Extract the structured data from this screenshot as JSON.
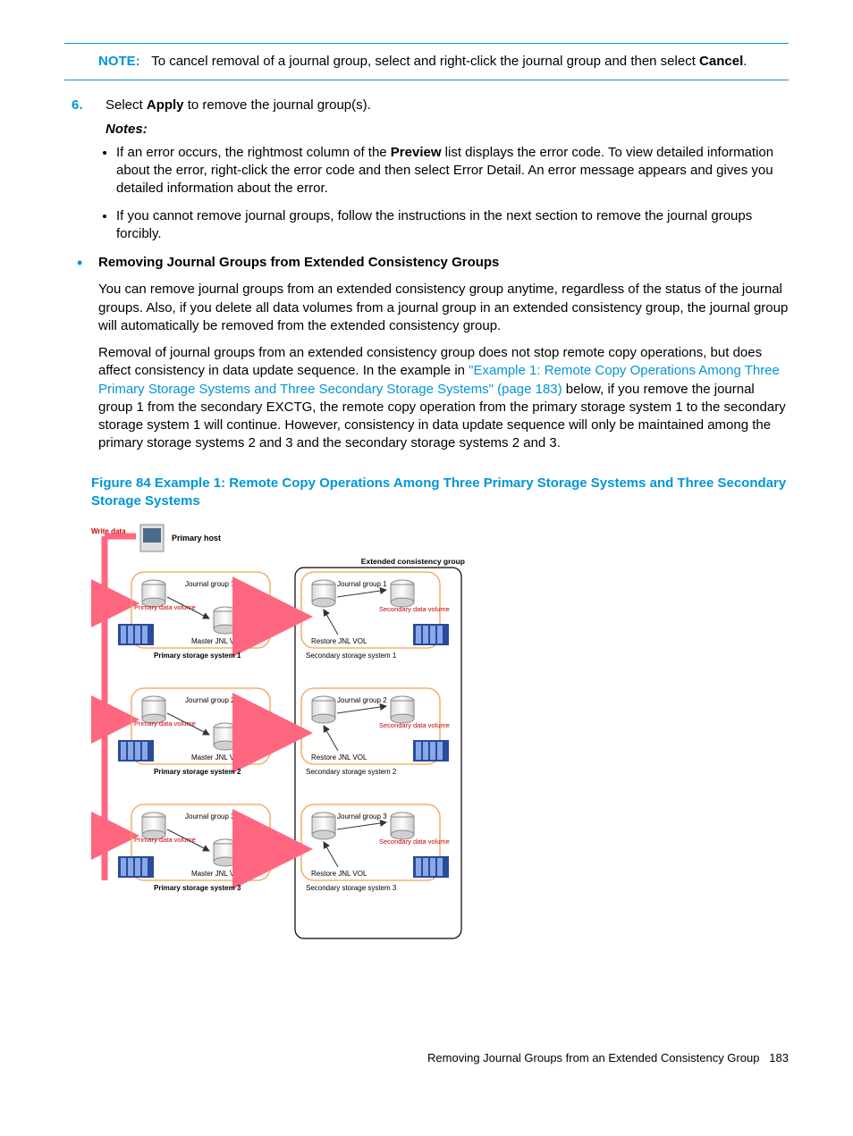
{
  "note": {
    "label": "NOTE:",
    "text1": "To cancel removal of a journal group, select and right-click the journal group and then select ",
    "bold": "Cancel",
    "text2": "."
  },
  "step6": {
    "num": "6.",
    "pre": "Select ",
    "bold": "Apply",
    "post": " to remove the journal group(s).",
    "notes_label": "Notes"
  },
  "bullets": {
    "b1_pre": "If an error occurs, the rightmost column of the ",
    "b1_bold": "Preview",
    "b1_post": " list displays the error code. To view detailed information about the error, right-click the error code and then select Error Detail. An error message appears and gives you detailed information about the error.",
    "b2": "If you cannot remove journal groups, follow the instructions in the next section to remove the journal groups forcibly."
  },
  "section": {
    "heading": "Removing Journal Groups from Extended Consistency Groups",
    "p1": "You can remove journal groups from an extended consistency group anytime, regardless of the status of the journal groups. Also, if you delete all data volumes from a journal group in an extended consistency group, the journal group will automatically be removed from the extended consistency group.",
    "p2_pre": "Removal of journal groups from an extended consistency group does not stop remote copy operations, but does affect consistency in data update sequence. In the example in ",
    "p2_link": "\"Example 1: Remote Copy Operations Among Three Primary Storage Systems and Three Secondary Storage Systems\" (page 183)",
    "p2_post": " below, if you remove the journal group 1 from the secondary EXCTG, the remote copy operation from the primary storage system 1 to the secondary storage system 1 will continue. However, consistency in data update sequence will only be maintained among the primary storage systems 2 and 3 and the secondary storage systems 2 and 3."
  },
  "figure": {
    "caption": "Figure 84 Example 1: Remote Copy Operations Among Three Primary Storage Systems and Three Secondary Storage Systems",
    "write_data": "Write data",
    "primary_host": "Primary host",
    "ext_group": "Extended consistency group",
    "jg1": "Journal group 1",
    "jg2": "Journal group 2",
    "jg3": "Journal group 3",
    "pdv": "Primary data volume",
    "sdv": "Secondary data volume",
    "mjv": "Master JNL VOL",
    "rjv": "Restore JNL VOL",
    "pss1": "Primary storage system 1",
    "pss2": "Primary storage system 2",
    "pss3": "Primary storage system 3",
    "sss1": "Secondary storage system 1",
    "sss2": "Secondary storage system 2",
    "sss3": "Secondary storage system 3"
  },
  "footer": {
    "text": "Removing Journal Groups from an Extended Consistency Group",
    "page": "183"
  }
}
